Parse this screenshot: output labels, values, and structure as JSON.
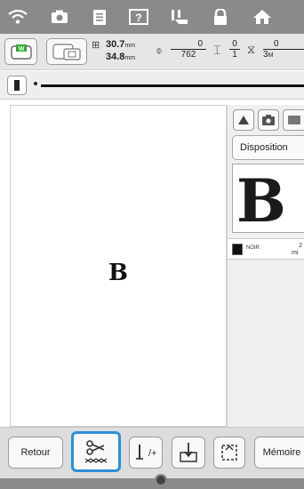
{
  "status_bar": {
    "icons": [
      "wifi-icon",
      "camera-icon",
      "document-icon",
      "help-icon",
      "presser-foot-icon",
      "lock-icon",
      "home-icon"
    ]
  },
  "info_bar": {
    "width_value": "30.7",
    "height_value": "34.8",
    "unit": "mm",
    "needle_numerator": "0",
    "needle_denominator": "762",
    "color_numerator": "0",
    "color_denominator": "1",
    "time_numerator": "0",
    "time_denominator": "3",
    "time_unit": "M"
  },
  "canvas": {
    "letter": "B"
  },
  "right_panel": {
    "disposition_label": "Disposition",
    "preview_letter": "B",
    "thread": {
      "name": "NOIR",
      "minutes_top": "2",
      "minutes_label": "mi",
      "color": "#111111"
    }
  },
  "bottom_bar": {
    "back_label": "Retour",
    "memory_label": "Mémoire"
  },
  "colors": {
    "accent_selected": "#2f8fd6",
    "topbar": "#8a8a8a"
  }
}
